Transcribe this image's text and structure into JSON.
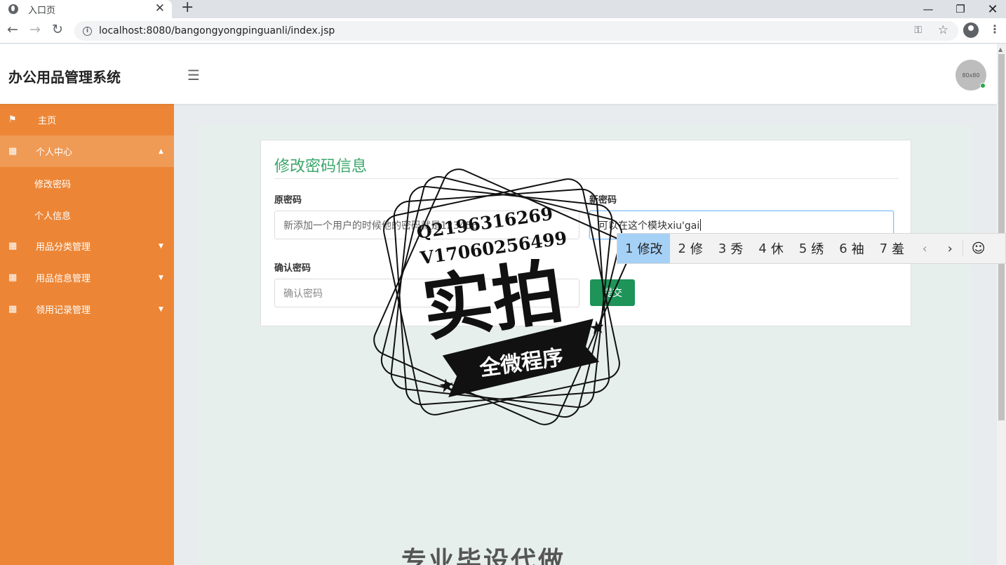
{
  "browser": {
    "tab_title": "入口页",
    "url": "localhost:8080/bangongyongpinguanli/index.jsp"
  },
  "app": {
    "brand": "办公用品管理系统",
    "avatar_text": "80x80"
  },
  "sidebar": {
    "items": [
      {
        "label": "主页",
        "icon": "flag-icon"
      },
      {
        "label": "个人中心",
        "icon": "grid-icon"
      },
      {
        "label": "用品分类管理",
        "icon": "grid-icon"
      },
      {
        "label": "用品信息管理",
        "icon": "grid-icon"
      },
      {
        "label": "领用记录管理",
        "icon": "grid-icon"
      }
    ],
    "sub_items": [
      {
        "label": "修改密码"
      },
      {
        "label": "个人信息"
      }
    ]
  },
  "form": {
    "title": "修改密码信息",
    "old_password_label": "原密码",
    "old_password_value": "新添加一个用户的时候他的密码就是123456",
    "new_password_label": "新密码",
    "new_password_value": "可以在这个模块xiu'gai",
    "confirm_label": "确认密码",
    "confirm_placeholder": "确认密码",
    "submit_label": "提交"
  },
  "ime": {
    "candidates": [
      {
        "num": "1",
        "text": "修改"
      },
      {
        "num": "2",
        "text": "修"
      },
      {
        "num": "3",
        "text": "秀"
      },
      {
        "num": "4",
        "text": "休"
      },
      {
        "num": "5",
        "text": "绣"
      },
      {
        "num": "6",
        "text": "袖"
      },
      {
        "num": "7",
        "text": "羞"
      }
    ]
  },
  "watermark": {
    "qq": "Q2196316269",
    "vx": "V17060256499",
    "main": "实拍",
    "banner": "全微程序",
    "bottom": "专业毕设代做"
  }
}
